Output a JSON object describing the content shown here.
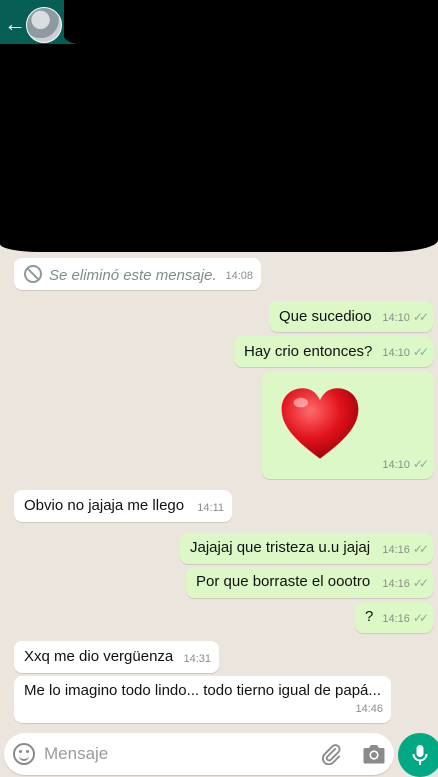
{
  "header": {
    "back_icon": "arrow-left-icon",
    "avatar_icon": "contact-avatar"
  },
  "messages": [
    {
      "direction": "in",
      "text": "Se eliminó este mensaje.",
      "time": "14:08",
      "deleted": true
    },
    {
      "direction": "out",
      "text": "Que sucedioo",
      "time": "14:10"
    },
    {
      "direction": "out",
      "text": "Hay crio entonces?",
      "time": "14:10"
    },
    {
      "direction": "out",
      "text": "",
      "emoji": "heart",
      "time": "14:10"
    },
    {
      "direction": "in",
      "text": "Obvio no jajaja me llego",
      "time": "14:11"
    },
    {
      "direction": "out",
      "text": "Jajajaj que tristeza u.u jajaj",
      "time": "14:16"
    },
    {
      "direction": "out",
      "text": "Por que borraste el oootro",
      "time": "14:16"
    },
    {
      "direction": "out",
      "text": "?",
      "time": "14:16"
    },
    {
      "direction": "in",
      "text": "Xxq me dio vergüenza",
      "time": "14:31"
    },
    {
      "direction": "in",
      "text": "Me lo imagino todo lindo... todo tierno igual de papá...",
      "time": "14:46"
    }
  ],
  "input": {
    "placeholder": "Mensaje"
  },
  "colors": {
    "header": "#075e54",
    "outgoing": "#dcf8c6",
    "incoming": "#ffffff",
    "background": "#ece5dd",
    "mic": "#00a884"
  }
}
